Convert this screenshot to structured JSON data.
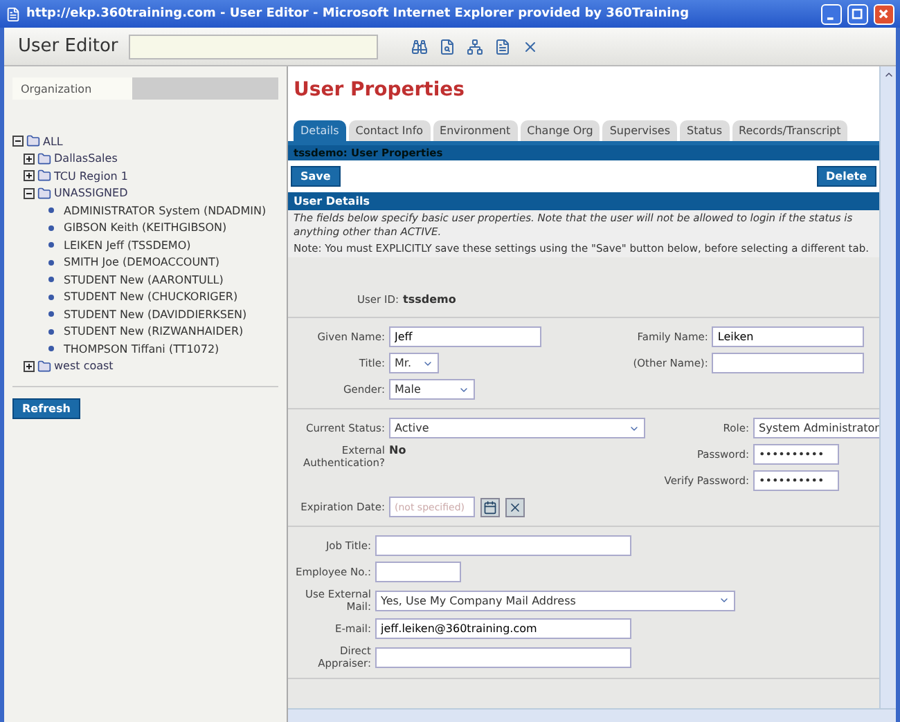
{
  "window": {
    "title": "http://ekp.360training.com - User Editor - Microsoft Internet Explorer provided by 360Training"
  },
  "toolbar": {
    "title": "User Editor"
  },
  "sidebar": {
    "tab": "Organization",
    "tree": [
      {
        "label": "ALL",
        "kind": "folder",
        "expanded": true,
        "children": [
          {
            "label": "DallasSales",
            "kind": "folder",
            "expanded": false
          },
          {
            "label": "TCU Region 1",
            "kind": "folder",
            "expanded": false
          },
          {
            "label": "UNASSIGNED",
            "kind": "folder",
            "expanded": true,
            "children": [
              {
                "label": "ADMINISTRATOR System (NDADMIN)",
                "kind": "user"
              },
              {
                "label": "GIBSON Keith (KEITHGIBSON)",
                "kind": "user"
              },
              {
                "label": "LEIKEN Jeff (TSSDEMO)",
                "kind": "user"
              },
              {
                "label": "SMITH Joe (DEMOACCOUNT)",
                "kind": "user"
              },
              {
                "label": "STUDENT New (AARONTULL)",
                "kind": "user"
              },
              {
                "label": "STUDENT New (CHUCKORIGER)",
                "kind": "user"
              },
              {
                "label": "STUDENT New (DAVIDDIERKSEN)",
                "kind": "user"
              },
              {
                "label": "STUDENT New (RIZWANHAIDER)",
                "kind": "user"
              },
              {
                "label": "THOMPSON Tiffani (TT1072)",
                "kind": "user"
              }
            ]
          },
          {
            "label": "west coast",
            "kind": "folder",
            "expanded": false
          }
        ]
      }
    ],
    "button": "Refresh"
  },
  "main": {
    "heading": "User Properties",
    "tabs": [
      {
        "label": "Details",
        "selected": true
      },
      {
        "label": "Contact Info",
        "selected": false
      },
      {
        "label": "Environment",
        "selected": false
      },
      {
        "label": "Change Org",
        "selected": false
      },
      {
        "label": "Supervises",
        "selected": false
      },
      {
        "label": "Status",
        "selected": false
      },
      {
        "label": "Records/Transcript",
        "selected": false
      }
    ],
    "band": "tssdemo: User Properties",
    "save": "Save",
    "delete": "Delete",
    "section_title": "User Details",
    "intro": "The fields below specify basic user properties. Note that the user will not be allowed to login if the status is anything other than ACTIVE.",
    "note": "Note: You must EXPLICITLY save these settings using the \"Save\" button below, before selecting a different tab.",
    "user_id_label": "User ID:",
    "user_id": "tssdemo",
    "sections": [
      {
        "left": [
          {
            "label": "Given Name:",
            "kind": "text",
            "value": "Jeff"
          },
          {
            "label": "Title:",
            "kind": "select",
            "value": "Mr."
          },
          {
            "label": "Gender:",
            "kind": "select",
            "value": "Male"
          }
        ],
        "right": [
          {
            "label": "Family Name:",
            "kind": "text",
            "value": "Leiken"
          },
          {
            "label": "(Other Name):",
            "kind": "text"
          }
        ]
      },
      {
        "left": [
          {
            "label": "Current Status:",
            "kind": "select",
            "value": "Active"
          },
          {
            "label": "External Authentication?",
            "kind": "static",
            "value": "No"
          }
        ],
        "right": [
          {
            "label": "Role:",
            "kind": "select",
            "value": "System Administrator"
          },
          {
            "label": "Password:",
            "kind": "password",
            "value": "••••••••••"
          },
          {
            "label": "Verify Password:",
            "kind": "password",
            "value": "••••••••••"
          }
        ],
        "after": [
          {
            "label": "Expiration Date:",
            "kind": "date",
            "placeholder": "(not specified)"
          }
        ]
      },
      {
        "left": [
          {
            "label": "Job Title:",
            "kind": "text"
          },
          {
            "label": "Employee No.:",
            "kind": "text"
          },
          {
            "label": "Use External Mail:",
            "kind": "select",
            "value": "Yes, Use My Company Mail Address"
          },
          {
            "label": "E-mail:",
            "kind": "text",
            "value": "jeff.leiken@360training.com"
          },
          {
            "label": "Direct Appraiser:",
            "kind": "text"
          }
        ]
      }
    ]
  }
}
